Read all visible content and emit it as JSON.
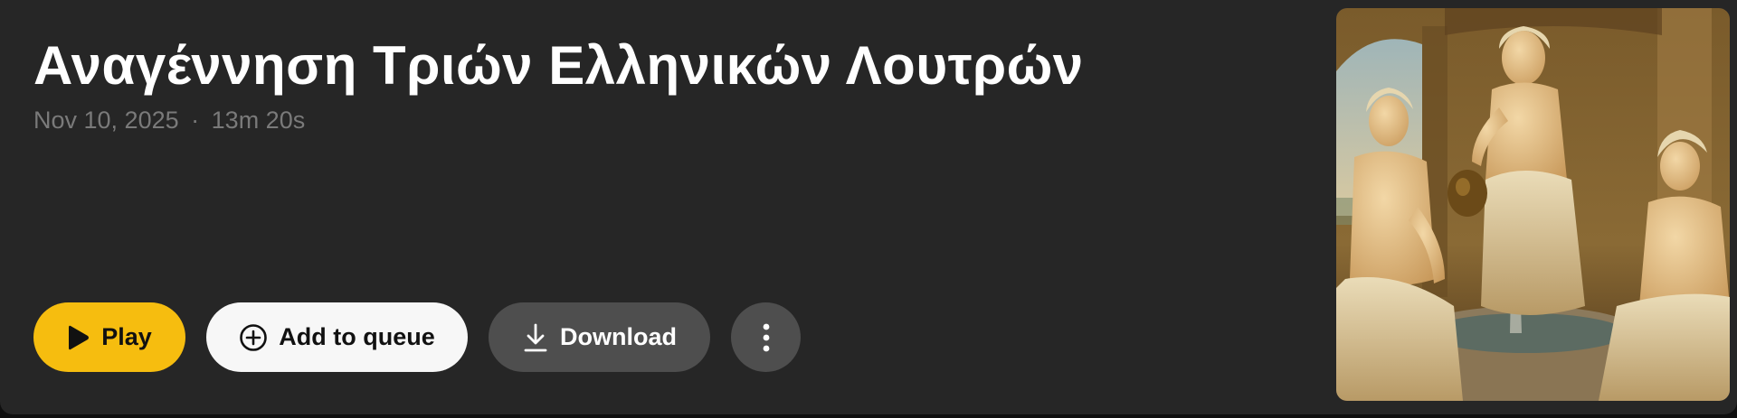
{
  "episode": {
    "title": "Αναγέννηση Τριών Ελληνικών Λουτρών",
    "date": "Nov 10, 2025",
    "separator": "·",
    "duration": "13m 20s"
  },
  "actions": {
    "play_label": "Play",
    "queue_label": "Add to queue",
    "download_label": "Download"
  },
  "icons": {
    "play": "play-icon",
    "queue": "plus-circle-icon",
    "download": "download-icon",
    "more": "more-vertical-icon"
  },
  "colors": {
    "background": "#262626",
    "accent": "#f6bd0f",
    "meta_text": "#7a7a7a",
    "secondary_button": "#4e4e4e"
  }
}
